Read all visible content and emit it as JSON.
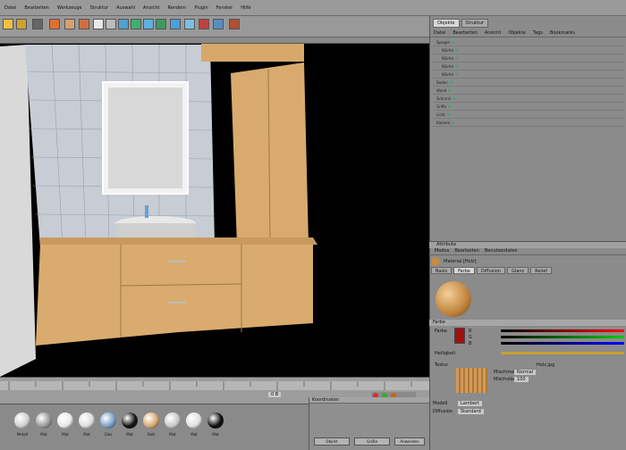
{
  "menu": [
    "Datei",
    "Bearbeiten",
    "Werkzeuge",
    "Struktur",
    "Auswahl",
    "Ansicht",
    "Rendern",
    "Plugin",
    "Fenster",
    "Hilfe"
  ],
  "objects": {
    "tabs": [
      "Objekte",
      "Struktur"
    ],
    "menu": [
      "Datei",
      "Bearbeiten",
      "Ansicht",
      "Objekte",
      "Tags",
      "Bookmarks"
    ],
    "rows": [
      "Spiegel",
      "Würfel",
      "Würfel",
      "Würfel",
      "Würfel",
      "Boden",
      "Wand",
      "Schrank",
      "Griffe",
      "Licht",
      "Kamera"
    ]
  },
  "attributes": {
    "title": "Attribute",
    "menu": [
      "Modus",
      "Bearbeiten",
      "Benutzerdaten"
    ],
    "object": "Material [Holz]",
    "tabs": [
      "Basis",
      "Farbe",
      "Diffusion",
      "Glanz",
      "Relief"
    ],
    "tab_active": "Farbe",
    "section": "Farbe",
    "color_label": "Farbe",
    "r": "R",
    "g": "G",
    "b": "B",
    "brightness_label": "Helligkeit",
    "texture_label": "Textur",
    "texture_name": "Holz.jpg",
    "mix_label": "Mischmodus",
    "mix_value": "Normal",
    "mix_strength_label": "Mischstärke",
    "mix_strength_value": "100",
    "model_label": "Modell",
    "model_value": "Lambert",
    "diffuse_label": "Diffusion",
    "diffuse_value": "Standard"
  },
  "timeline": {
    "frame": "0 B"
  },
  "materials": [
    {
      "name": "Metall",
      "color": "#cfcfcf"
    },
    {
      "name": "Mat",
      "color": "#9a9a9a"
    },
    {
      "name": "Mat",
      "color": "#e8e8e8"
    },
    {
      "name": "Mat",
      "color": "#dcdcdc"
    },
    {
      "name": "Glas",
      "color": "#7aa0c8"
    },
    {
      "name": "Mat",
      "color": "#111111"
    },
    {
      "name": "Holz",
      "color": "#d9a870"
    },
    {
      "name": "Mat",
      "color": "#c9c9c9"
    },
    {
      "name": "Mat",
      "color": "#e0e0e0"
    },
    {
      "name": "Mat",
      "color": "#0c0c0c"
    }
  ],
  "coords": {
    "title": "Koordinaten",
    "apply": "Anwenden",
    "mode": "Objekt",
    "size_mode": "Größe"
  }
}
